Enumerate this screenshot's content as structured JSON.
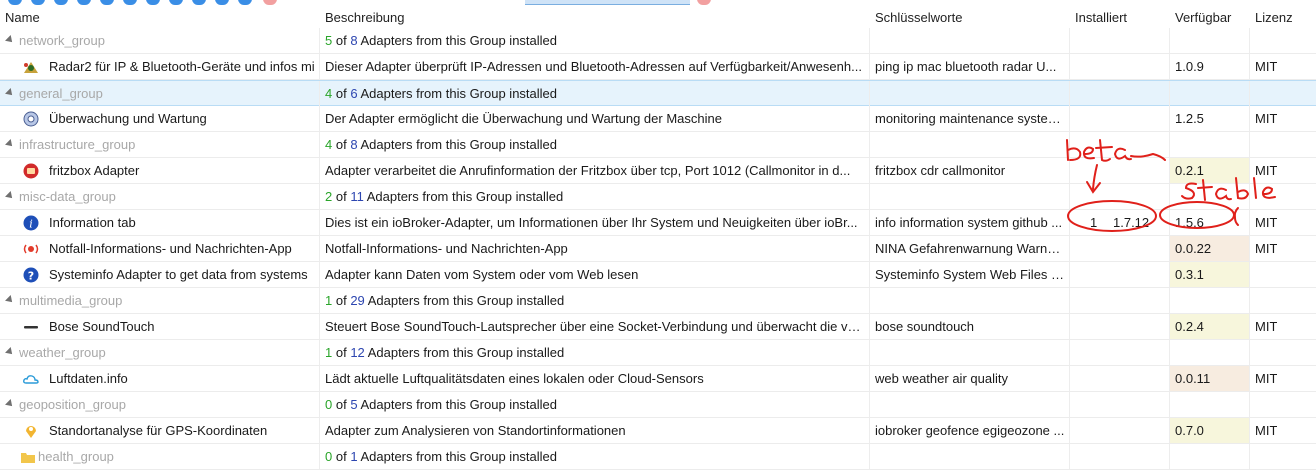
{
  "columns": {
    "name": "Name",
    "description": "Beschreibung",
    "keywords": "Schlüsselworte",
    "installed": "Installiert",
    "available": "Verfügbar",
    "license": "Lizenz"
  },
  "group_suffix": "Adapters from this Group installed",
  "group_of": "of",
  "rows": [
    {
      "type": "group",
      "name": "network_group",
      "installed": "5",
      "total": "8"
    },
    {
      "type": "adapter",
      "icon": "radar-icon",
      "name": "Radar2 für IP & Bluetooth-Geräte und infos mi",
      "description": "Dieser Adapter überprüft IP-Adressen und Bluetooth-Adressen auf Verfügbarkeit/Anwesenh...",
      "keywords": "ping ip mac bluetooth radar U...",
      "installed": "",
      "available": "1.0.9",
      "avail_bg": "",
      "license": "MIT"
    },
    {
      "type": "group",
      "name": "general_group",
      "installed": "4",
      "total": "6",
      "selected": true
    },
    {
      "type": "adapter",
      "icon": "gear-globe-icon",
      "name": "Überwachung und Wartung",
      "description": "Der Adapter ermöglicht die Überwachung und Wartung der Maschine",
      "keywords": "monitoring maintenance system...",
      "installed": "",
      "available": "1.2.5",
      "avail_bg": "",
      "license": "MIT"
    },
    {
      "type": "group",
      "name": "infrastructure_group",
      "installed": "4",
      "total": "8"
    },
    {
      "type": "adapter",
      "icon": "fritzbox-icon",
      "name": "fritzbox Adapter",
      "description": "Adapter verarbeitet die Anrufinformation der Fritzbox über tcp, Port 1012 (Callmonitor in d...",
      "keywords": "fritzbox cdr callmonitor",
      "installed": "",
      "available": "0.2.1",
      "avail_bg": "yellow",
      "license": "MIT"
    },
    {
      "type": "group",
      "name": "misc-data_group",
      "installed": "2",
      "total": "11"
    },
    {
      "type": "adapter",
      "icon": "info-icon",
      "name": "Information tab",
      "description": "Dies ist ein ioBroker-Adapter, um Informationen über Ihr System und Neuigkeiten über ioBr...",
      "keywords": "info information system github ...",
      "installed_count": "1",
      "installed": "1.7.12",
      "available": "1.5.6",
      "avail_bg": "",
      "license": "MIT"
    },
    {
      "type": "adapter",
      "icon": "alert-icon",
      "name": "Notfall-Informations- und Nachrichten-App",
      "description": "Notfall-Informations- und Nachrichten-App",
      "keywords": "NINA Gefahrenwarnung Warnu...",
      "installed": "",
      "available": "0.0.22",
      "avail_bg": "peach",
      "license": "MIT"
    },
    {
      "type": "adapter",
      "icon": "question-icon",
      "name": "Systeminfo Adapter to get data from systems",
      "description": "Adapter kann Daten vom System oder vom Web lesen",
      "keywords": "Systeminfo System Web Files JS...",
      "installed": "",
      "available": "0.3.1",
      "avail_bg": "yellow",
      "license": ""
    },
    {
      "type": "group",
      "name": "multimedia_group",
      "installed": "1",
      "total": "29"
    },
    {
      "type": "adapter",
      "icon": "soundbar-icon",
      "name": "Bose SoundTouch",
      "description": "Steuert Bose SoundTouch-Lautsprecher über eine Socket-Verbindung und überwacht die vo...",
      "keywords": "bose soundtouch",
      "installed": "",
      "available": "0.2.4",
      "avail_bg": "yellow",
      "license": "MIT"
    },
    {
      "type": "group",
      "name": "weather_group",
      "installed": "1",
      "total": "12"
    },
    {
      "type": "adapter",
      "icon": "cloud-icon",
      "name": "Luftdaten.info",
      "description": "Lädt aktuelle Luftqualitätsdaten eines lokalen oder Cloud-Sensors",
      "keywords": "web weather air quality",
      "installed": "",
      "available": "0.0.11",
      "avail_bg": "peach",
      "license": "MIT"
    },
    {
      "type": "group",
      "name": "geoposition_group",
      "installed": "0",
      "total": "5"
    },
    {
      "type": "adapter",
      "icon": "location-icon",
      "name": "Standortanalyse für GPS-Koordinaten",
      "description": "Adapter zum Analysieren von Standortinformationen",
      "keywords": "iobroker geofence egigeozone ...",
      "installed": "",
      "available": "0.7.0",
      "avail_bg": "yellow",
      "license": "MIT"
    },
    {
      "type": "group",
      "name": "health_group",
      "installed": "0",
      "total": "1",
      "folder": true
    }
  ],
  "annotations": {
    "beta": "beta",
    "stable": "stable",
    "color": "#e0201a"
  },
  "colors": {
    "installed_count": "#2aa52a",
    "total_count": "#2d46b0",
    "group_name": "#a8a8a8",
    "selected_row": "#e6f3fc"
  }
}
